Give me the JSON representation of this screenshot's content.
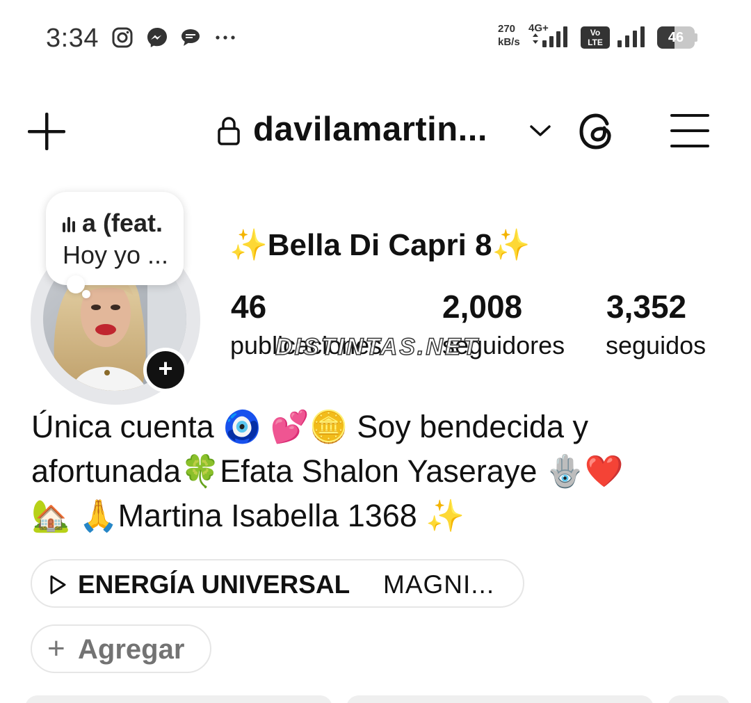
{
  "status_bar": {
    "time": "3:34",
    "notification_icons": [
      "instagram-icon",
      "messenger-icon",
      "chat-icon",
      "more-dots-icon"
    ],
    "net_speed_value": "270",
    "net_speed_unit": "kB/s",
    "network_type": "4G+",
    "volte_line1": "Vo",
    "volte_line2": "LTE",
    "battery_level": "46"
  },
  "header": {
    "username": "davilamartin...",
    "icons": [
      "plus-icon",
      "lock-icon",
      "chevron-down-icon",
      "threads-icon",
      "menu-icon"
    ]
  },
  "note": {
    "music_text": "a (feat.",
    "text": "Hoy yo ..."
  },
  "profile": {
    "display_name": "✨Bella Di Capri 8✨",
    "stats": [
      {
        "value": "46",
        "label": "publicaciones"
      },
      {
        "value": "2,008",
        "label": "seguidores"
      },
      {
        "value": "3,352",
        "label": "seguidos"
      }
    ],
    "watermark": "DISTINTAS.NET",
    "bio_lines": [
      "Única  cuenta  🧿 💕🪙 Soy bendecida y",
      "afortunada🍀Efata  Shalon  Yaseraye 🪬❤️",
      "🏡 🙏Martina Isabella 1368 ✨"
    ]
  },
  "music": {
    "title": "ENERGÍA UNIVERSAL",
    "artist": "MAGNI..."
  },
  "add_link": {
    "plus": "+",
    "label": "Agregar"
  },
  "colors": {
    "text": "#111111",
    "muted": "#737373",
    "pill_border": "#e6e6e6",
    "avatar_ring": "#e6e7ea"
  }
}
